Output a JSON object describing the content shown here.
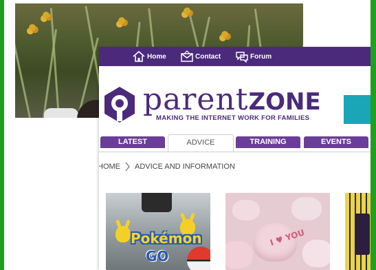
{
  "topnav": {
    "items": [
      {
        "label": "Home",
        "icon": "house-icon"
      },
      {
        "label": "Contact",
        "icon": "envelope-icon"
      },
      {
        "label": "Forum",
        "icon": "speech-bubbles-icon"
      }
    ],
    "background": "#4b2a7b"
  },
  "logo": {
    "word_part1": "parent",
    "word_part2": "ZONE",
    "tagline": "MAKING THE INTERNET WORK FOR FAMILIES",
    "brand_color": "#4b2a7b"
  },
  "tabs": [
    {
      "label": "LATEST",
      "active": false
    },
    {
      "label": "ADVICE",
      "active": true
    },
    {
      "label": "TRAINING",
      "active": false
    },
    {
      "label": "EVENTS",
      "active": false
    }
  ],
  "breadcrumb": {
    "items": [
      "HOME",
      "ADVICE AND INFORMATION"
    ]
  },
  "cards": [
    {
      "image": "pokemon-go-image",
      "text": [
        "Pokémon",
        "GO"
      ]
    },
    {
      "image": "candy-hearts-image",
      "text": [
        "I ♥ YOU"
      ]
    },
    {
      "image": "partial-app-screenshot-image"
    }
  ],
  "colors": {
    "accent_green": "#1e9e1e",
    "tab_purple": "#6a3d9a",
    "teal": "#1aa6b7"
  }
}
